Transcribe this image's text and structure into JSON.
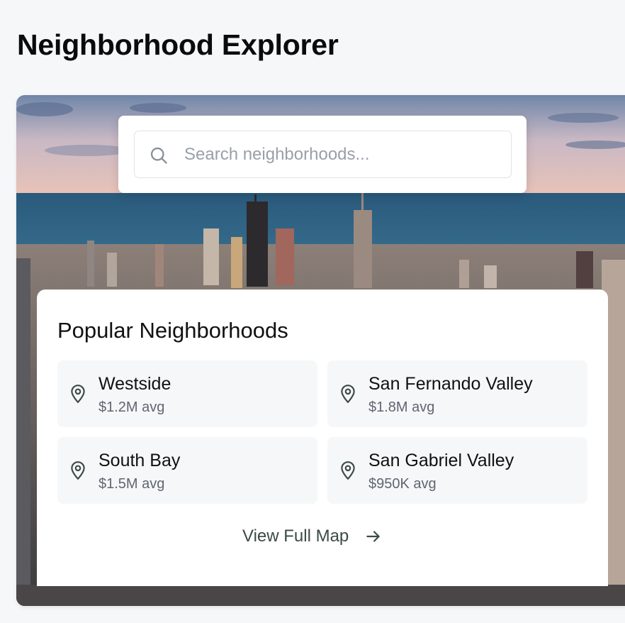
{
  "page": {
    "title": "Neighborhood Explorer"
  },
  "search": {
    "placeholder": "Search neighborhoods..."
  },
  "popular": {
    "title": "Popular Neighborhoods",
    "items": [
      {
        "name": "Westside",
        "price": "$1.2M avg",
        "icon": "map-pin-icon"
      },
      {
        "name": "San Fernando Valley",
        "price": "$1.8M avg",
        "icon": "map-pin-icon"
      },
      {
        "name": "South Bay",
        "price": "$1.5M avg",
        "icon": "map-pin-icon"
      },
      {
        "name": "San Gabriel Valley",
        "price": "$950K avg",
        "icon": "map-pin-icon"
      }
    ],
    "view_map_label": "View Full Map",
    "view_map_icon": "arrow-right-icon"
  },
  "colors": {
    "page_bg": "#f6f7f9",
    "card_bg": "#f6f7f9",
    "icon_color": "#3b4a46",
    "muted_text": "#5f6670"
  }
}
